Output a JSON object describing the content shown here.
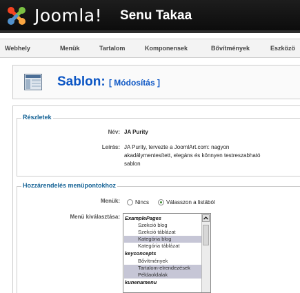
{
  "header": {
    "brand": "Joomla!",
    "site_name": "Senu Takaa"
  },
  "menu": {
    "items": [
      "Webhely",
      "Menük",
      "Tartalom",
      "Komponensek",
      "Bővítmények",
      "Eszközö"
    ]
  },
  "toolbar": {
    "title": "Sablon:",
    "subtitle": "[ Módosítás ]"
  },
  "details": {
    "legend": "Részletek",
    "name_label": "Név:",
    "name_value": "JA Purity",
    "desc_label": "Leírás:",
    "desc_lines": [
      "JA Purity, tervezte a JoomlArt.com: nagyon",
      "akadálymentesített, elegáns és könnyen testreszabható",
      "sablon"
    ]
  },
  "assign": {
    "legend": "Hozzárendelés menüpontokhoz",
    "menus_label": "Menük:",
    "radio_none": "Nincs",
    "radio_select": "Válasszon a listából",
    "select_label": "Menü kiválasztása:"
  },
  "listbox": {
    "options": [
      {
        "text": "ExamplePages",
        "type": "group",
        "selected": false
      },
      {
        "text": "Szekció blog",
        "type": "item",
        "selected": false
      },
      {
        "text": "Szekció táblázat",
        "type": "item",
        "selected": false
      },
      {
        "text": "Kategória blog",
        "type": "item",
        "selected": true
      },
      {
        "text": "Kategória táblázat",
        "type": "item",
        "selected": false
      },
      {
        "text": "keyconcepts",
        "type": "group",
        "selected": false
      },
      {
        "text": "Bővítmények",
        "type": "item",
        "selected": false
      },
      {
        "text": "Tartalom-elrendezések",
        "type": "item",
        "selected": true
      },
      {
        "text": "Példaoldalak",
        "type": "item",
        "selected": true
      },
      {
        "text": "kunenamenu",
        "type": "group",
        "selected": false
      }
    ]
  },
  "colors": {
    "title_blue": "#0b55c4",
    "legend_blue": "#146295",
    "selected_option": "#c6c6d6"
  }
}
